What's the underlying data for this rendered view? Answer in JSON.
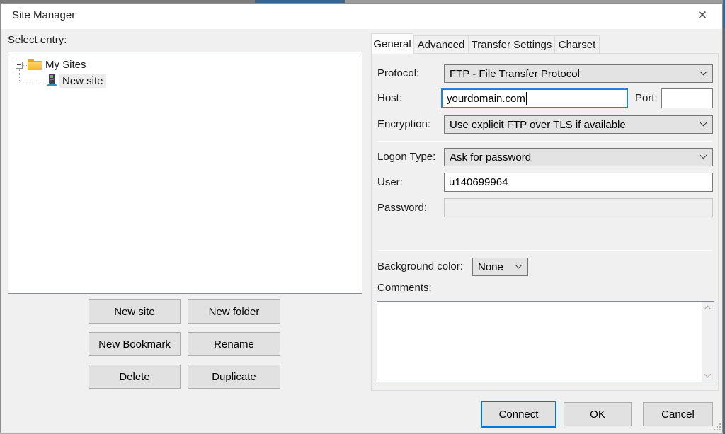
{
  "window": {
    "title": "Site Manager",
    "close_glyph": "✕"
  },
  "sidebar": {
    "select_entry_label": "Select entry:",
    "tree": {
      "root_label": "My Sites",
      "child_label": "New site"
    },
    "buttons": [
      "New site",
      "New folder",
      "New Bookmark",
      "Rename",
      "Delete",
      "Duplicate"
    ]
  },
  "tabs": [
    "General",
    "Advanced",
    "Transfer Settings",
    "Charset"
  ],
  "general": {
    "protocol_label": "Protocol:",
    "protocol_value": "FTP - File Transfer Protocol",
    "host_label": "Host:",
    "host_value": "yourdomain.com",
    "port_label": "Port:",
    "port_value": "",
    "encryption_label": "Encryption:",
    "encryption_value": "Use explicit FTP over TLS if available",
    "logon_type_label": "Logon Type:",
    "logon_type_value": "Ask for password",
    "user_label": "User:",
    "user_value": "u140699964",
    "password_label": "Password:",
    "password_value": "",
    "background_color_label": "Background color:",
    "background_color_value": "None",
    "comments_label": "Comments:",
    "comments_value": ""
  },
  "footer": {
    "connect_label": "Connect",
    "ok_label": "OK",
    "cancel_label": "Cancel"
  },
  "colors": {
    "accent_blue": "#0078d7",
    "dialog_bg": "#f0f0f0",
    "focused_input_border": "#2a7fd4",
    "folder_yellow": "#f3b62a",
    "server_light_green": "#55c24e",
    "server_base_blue": "#3f8fc4"
  }
}
